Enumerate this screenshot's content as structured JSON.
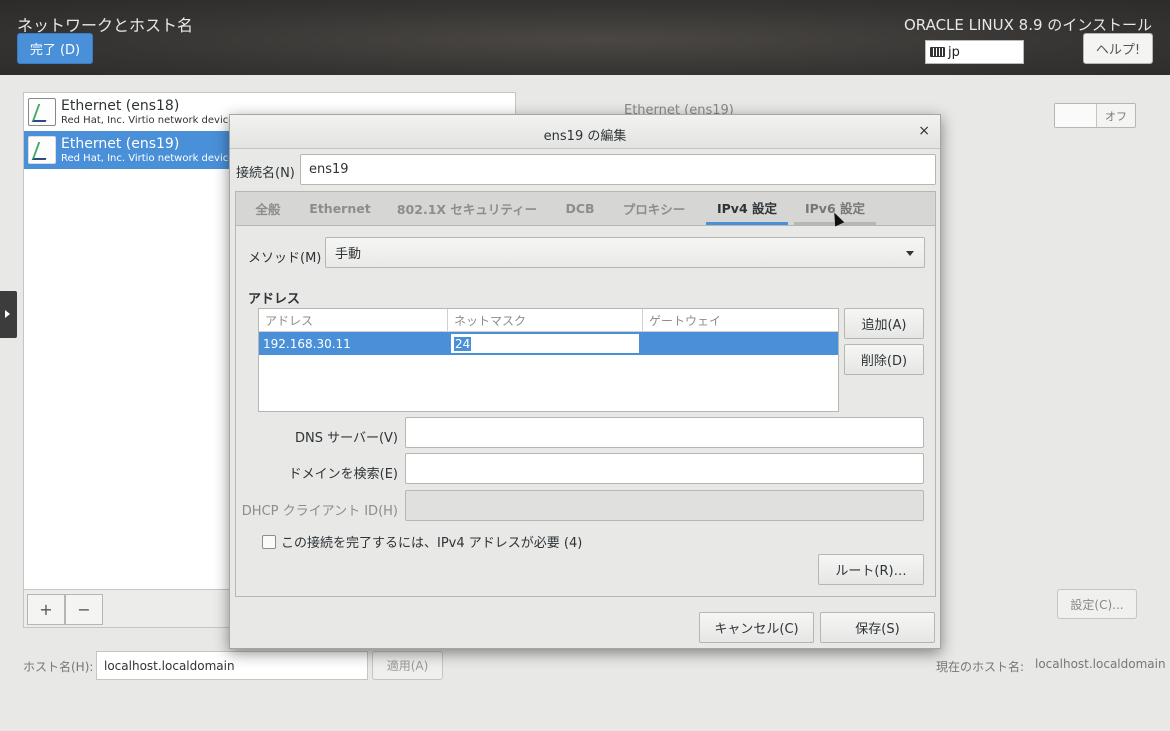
{
  "header": {
    "title": "ネットワークとホスト名",
    "done_label": "完了 (D)",
    "install_title": "ORACLE LINUX 8.9 のインストール",
    "keyboard_layout": "jp",
    "help_label": "ヘルプ!"
  },
  "devices": [
    {
      "name": "Ethernet (ens18)",
      "description": "Red Hat, Inc. Virtio network device",
      "selected": false
    },
    {
      "name": "Ethernet (ens19)",
      "description": "Red Hat, Inc. Virtio network device",
      "selected": true
    }
  ],
  "list_tools": {
    "add": "+",
    "remove": "−"
  },
  "right_panel": {
    "device_title": "Ethernet (ens19)",
    "toggle_label": "オフ",
    "settings_label": "設定(C)..."
  },
  "hostname": {
    "label": "ホスト名(H):",
    "value": "localhost.localdomain",
    "apply_label": "適用(A)",
    "current_label": "現在のホスト名:",
    "current_value": "localhost.localdomain"
  },
  "dialog": {
    "title": "ens19 の編集",
    "close": "×",
    "connection_name_label": "接続名(N)",
    "connection_name_value": "ens19",
    "tabs": [
      {
        "label": "全般"
      },
      {
        "label": "Ethernet"
      },
      {
        "label": "802.1X セキュリティー"
      },
      {
        "label": "DCB"
      },
      {
        "label": "プロキシー"
      },
      {
        "label": "IPv4 設定"
      },
      {
        "label": "IPv6 設定"
      }
    ],
    "active_tab": "IPv4 設定",
    "method_label": "メソッド(M)",
    "method_value": "手動",
    "addresses_heading": "アドレス",
    "address_columns": [
      "アドレス",
      "ネットマスク",
      "ゲートウェイ"
    ],
    "address_rows": [
      {
        "address": "192.168.30.11",
        "netmask": "24",
        "gateway": ""
      }
    ],
    "add_label": "追加(A)",
    "delete_label": "削除(D)",
    "dns_label": "DNS サーバー(V)",
    "search_domains_label": "ドメインを検索(E)",
    "dhcp_client_id_label": "DHCP クライアント ID(H)",
    "require_ipv4_label": "この接続を完了するには、IPv4 アドレスが必要 (4)",
    "routes_label": "ルート(R)…",
    "cancel_label": "キャンセル(C)",
    "save_label": "保存(S)"
  }
}
